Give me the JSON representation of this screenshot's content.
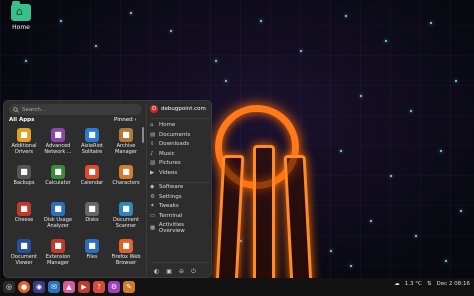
{
  "desktop": {
    "home_label": "Home"
  },
  "menu": {
    "search_placeholder": "Search...",
    "all_apps": "All Apps",
    "pinned": "Pinned",
    "apps": [
      {
        "label": "Additional Drivers",
        "icon": "driver-icon",
        "color": "#e0a020"
      },
      {
        "label": "Advanced Network ...",
        "icon": "network-icon",
        "color": "#8e44ad"
      },
      {
        "label": "AisleRiot Solitaire",
        "icon": "cards-icon",
        "color": "#2a7bd6"
      },
      {
        "label": "Archive Manager",
        "icon": "archive-icon",
        "color": "#b07a3a"
      },
      {
        "label": "Backups",
        "icon": "backup-icon",
        "color": "#555555"
      },
      {
        "label": "Calculator",
        "icon": "calculator-icon",
        "color": "#3c8a3c"
      },
      {
        "label": "Calendar",
        "icon": "calendar-icon",
        "color": "#e04a2a"
      },
      {
        "label": "Characters",
        "icon": "characters-icon",
        "color": "#d87a2a"
      },
      {
        "label": "Cheese",
        "icon": "cheese-icon",
        "color": "#c0392b"
      },
      {
        "label": "Disk Usage Analyzer",
        "icon": "disk-usage-icon",
        "color": "#2a70c0"
      },
      {
        "label": "Disks",
        "icon": "disks-icon",
        "color": "#666666"
      },
      {
        "label": "Document Scanner",
        "icon": "scanner-icon",
        "color": "#2e86c1"
      },
      {
        "label": "Document Viewer",
        "icon": "viewer-icon",
        "color": "#2a4fa0"
      },
      {
        "label": "Extension Manager",
        "icon": "extension-icon",
        "color": "#c0392b"
      },
      {
        "label": "Files",
        "icon": "files-icon",
        "color": "#2a70c0"
      },
      {
        "label": "Firefox Web Browser",
        "icon": "firefox-icon",
        "color": "#e2612a"
      }
    ]
  },
  "places": [
    {
      "label": "Home",
      "icon": "home-icon"
    },
    {
      "label": "Documents",
      "icon": "documents-icon"
    },
    {
      "label": "Downloads",
      "icon": "downloads-icon"
    },
    {
      "label": "Music",
      "icon": "music-icon"
    },
    {
      "label": "Pictures",
      "icon": "pictures-icon"
    },
    {
      "label": "Videos",
      "icon": "videos-icon"
    }
  ],
  "system": [
    {
      "label": "Software",
      "icon": "software-icon"
    },
    {
      "label": "Settings",
      "icon": "settings-icon"
    },
    {
      "label": "Tweaks",
      "icon": "tweaks-icon"
    },
    {
      "label": "Terminal",
      "icon": "terminal-icon"
    },
    {
      "label": "Activities Overview",
      "icon": "activities-icon"
    }
  ],
  "user": {
    "name": "debugpoint.com",
    "initial": "D"
  },
  "tray": {
    "temp": "1.3 °C",
    "datetime": "Dec 2  08:16"
  }
}
